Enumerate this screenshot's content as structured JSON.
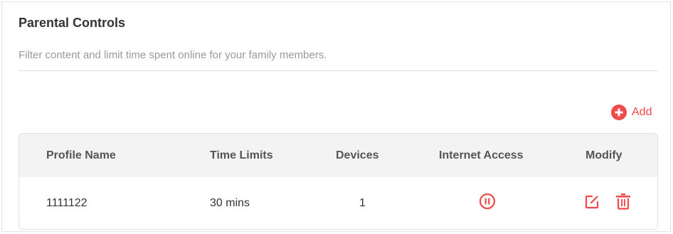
{
  "section": {
    "title": "Parental Controls",
    "description": "Filter content and limit time spent online for your family members."
  },
  "toolbar": {
    "add_label": "Add",
    "add_icon": "plus-circle-icon"
  },
  "table": {
    "columns": [
      "Profile Name",
      "Time Limits",
      "Devices",
      "Internet Access",
      "Modify"
    ],
    "rows": [
      {
        "profile_name": "1111122",
        "time_limits": "30 mins",
        "devices": "1",
        "internet_access_icon": "pause-circle-icon",
        "modify_icons": [
          "edit-icon",
          "delete-icon"
        ]
      }
    ]
  },
  "colors": {
    "accent": "#f04a4a",
    "header_bg": "#f3f3f3",
    "muted_text": "#9a9a9a"
  }
}
